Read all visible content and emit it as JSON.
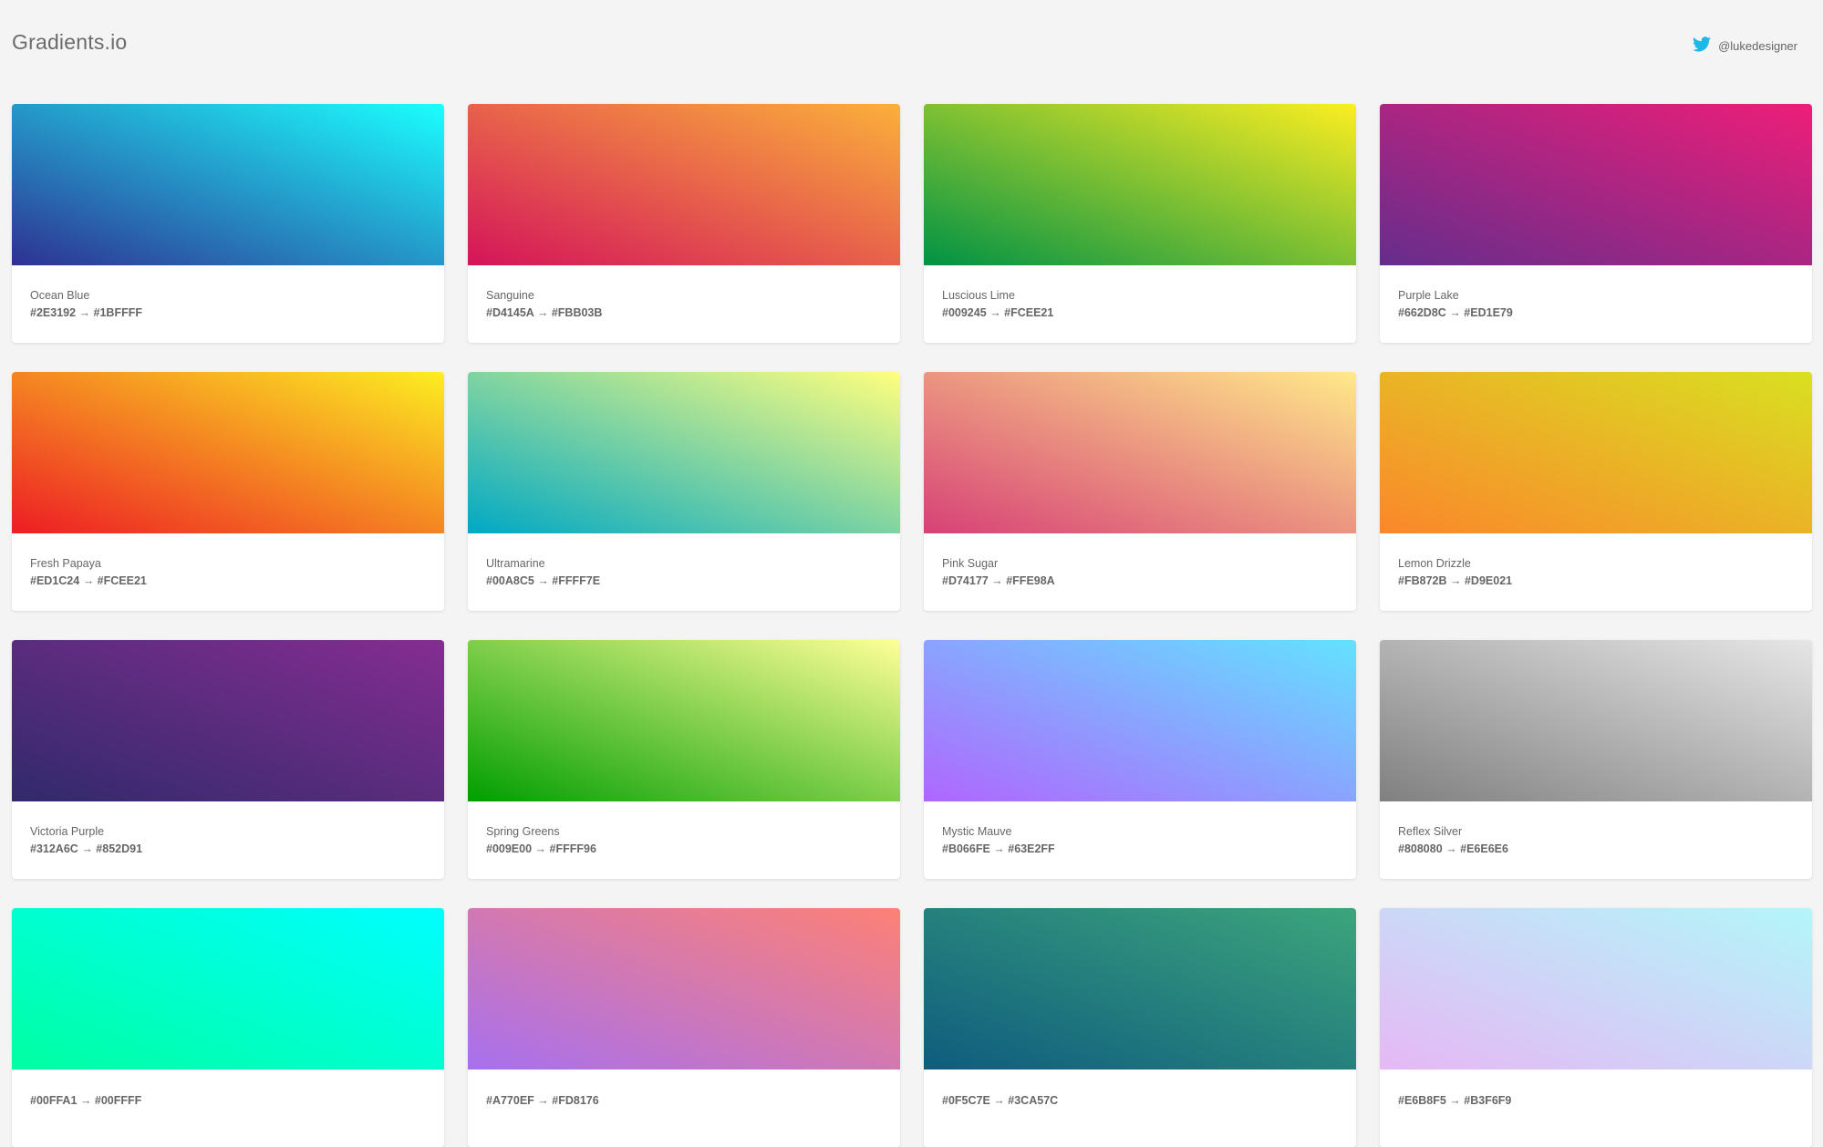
{
  "header": {
    "logo": "Gradients.io",
    "twitter_handle": "@lukedesigner",
    "twitter_icon": "twitter-bird-icon",
    "twitter_color": "#1fb7e5"
  },
  "arrow": "→",
  "gradients": [
    {
      "name": "Ocean Blue",
      "from": "#2E3192",
      "to": "#1BFFFF"
    },
    {
      "name": "Sanguine",
      "from": "#D4145A",
      "to": "#FBB03B"
    },
    {
      "name": "Luscious Lime",
      "from": "#009245",
      "to": "#FCEE21"
    },
    {
      "name": "Purple Lake",
      "from": "#662D8C",
      "to": "#ED1E79"
    },
    {
      "name": "Fresh Papaya",
      "from": "#ED1C24",
      "to": "#FCEE21"
    },
    {
      "name": "Ultramarine",
      "from": "#00A8C5",
      "to": "#FFFF7E"
    },
    {
      "name": "Pink Sugar",
      "from": "#D74177",
      "to": "#FFE98A"
    },
    {
      "name": "Lemon Drizzle",
      "from": "#FB872B",
      "to": "#D9E021"
    },
    {
      "name": "Victoria Purple",
      "from": "#312A6C",
      "to": "#852D91"
    },
    {
      "name": "Spring Greens",
      "from": "#009E00",
      "to": "#FFFF96"
    },
    {
      "name": "Mystic Mauve",
      "from": "#B066FE",
      "to": "#63E2FF"
    },
    {
      "name": "Reflex Silver",
      "from": "#808080",
      "to": "#E6E6E6"
    },
    {
      "name": "",
      "from": "#00FFA1",
      "to": "#00FFFF"
    },
    {
      "name": "",
      "from": "#A770EF",
      "to": "#FD8176"
    },
    {
      "name": "",
      "from": "#0F5C7E",
      "to": "#3CA57C"
    },
    {
      "name": "",
      "from": "#E6B8F5",
      "to": "#B3F6F9"
    }
  ]
}
